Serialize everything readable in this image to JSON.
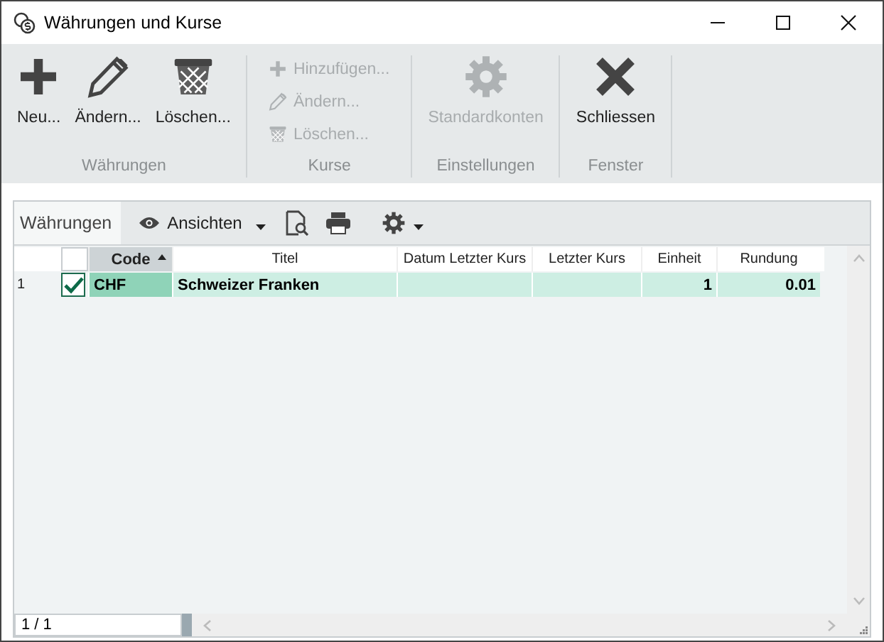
{
  "window": {
    "title": "Währungen und Kurse"
  },
  "ribbon": [
    {
      "label": "Währungen",
      "kind": "large",
      "items": [
        {
          "label": "Neu...",
          "kind": "plus",
          "disabled": false
        },
        {
          "label": "Ändern...",
          "kind": "pencil",
          "disabled": false
        },
        {
          "label": "Löschen...",
          "kind": "trash",
          "disabled": false
        }
      ]
    },
    {
      "label": "Kurse",
      "kind": "small",
      "items": [
        {
          "label": "Hinzufügen...",
          "kind": "plus",
          "disabled": true
        },
        {
          "label": "Ändern...",
          "kind": "pencil",
          "disabled": true
        },
        {
          "label": "Löschen...",
          "kind": "trash",
          "disabled": true
        }
      ]
    },
    {
      "label": "Einstellungen",
      "kind": "large",
      "items": [
        {
          "label": "Standardkonten",
          "kind": "gear",
          "disabled": true
        }
      ]
    },
    {
      "label": "Fenster",
      "kind": "large",
      "items": [
        {
          "label": "Schliessen",
          "kind": "close",
          "disabled": false
        }
      ]
    }
  ],
  "grid": {
    "tab": "Währungen",
    "views_button": "Ansichten",
    "all_checked": false,
    "columns": [
      {
        "label": "Code",
        "kind": "text",
        "sorted": true
      },
      {
        "label": "Titel",
        "kind": "text",
        "sorted": false
      },
      {
        "label": "Datum Letzter Kurs",
        "kind": "text",
        "sorted": false
      },
      {
        "label": "Letzter Kurs",
        "kind": "number",
        "sorted": false
      },
      {
        "label": "Einheit",
        "kind": "number",
        "sorted": false
      },
      {
        "label": "Rundung",
        "kind": "number",
        "sorted": false
      }
    ],
    "rows": [
      {
        "number": "1",
        "checked": true,
        "selected": true,
        "cells": [
          "CHF",
          "Schweizer Franken",
          "",
          "",
          "1",
          "0.01"
        ]
      }
    ],
    "pager": "1 / 1"
  }
}
